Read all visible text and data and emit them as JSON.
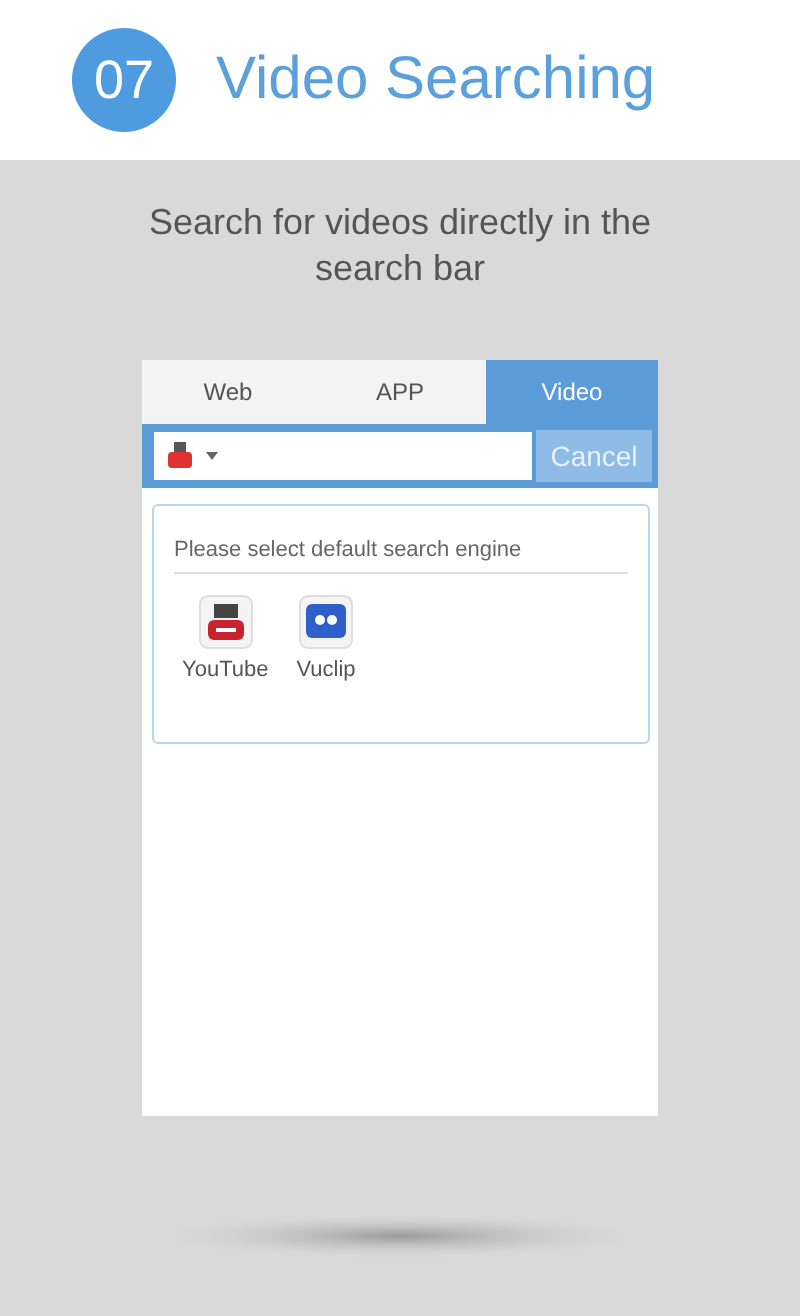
{
  "header": {
    "step": "07",
    "title": "Video Searching"
  },
  "caption": "Search for videos directly in the search bar",
  "phone": {
    "tabs": [
      {
        "label": "Web",
        "selected": false
      },
      {
        "label": "APP",
        "selected": false
      },
      {
        "label": "Video",
        "selected": true
      }
    ],
    "search": {
      "cancel": "Cancel"
    },
    "engine_panel": {
      "prompt": "Please select default search engine",
      "engines": [
        {
          "label": "YouTube",
          "kind": "youtube"
        },
        {
          "label": "Vuclip",
          "kind": "vuclip"
        }
      ]
    }
  }
}
